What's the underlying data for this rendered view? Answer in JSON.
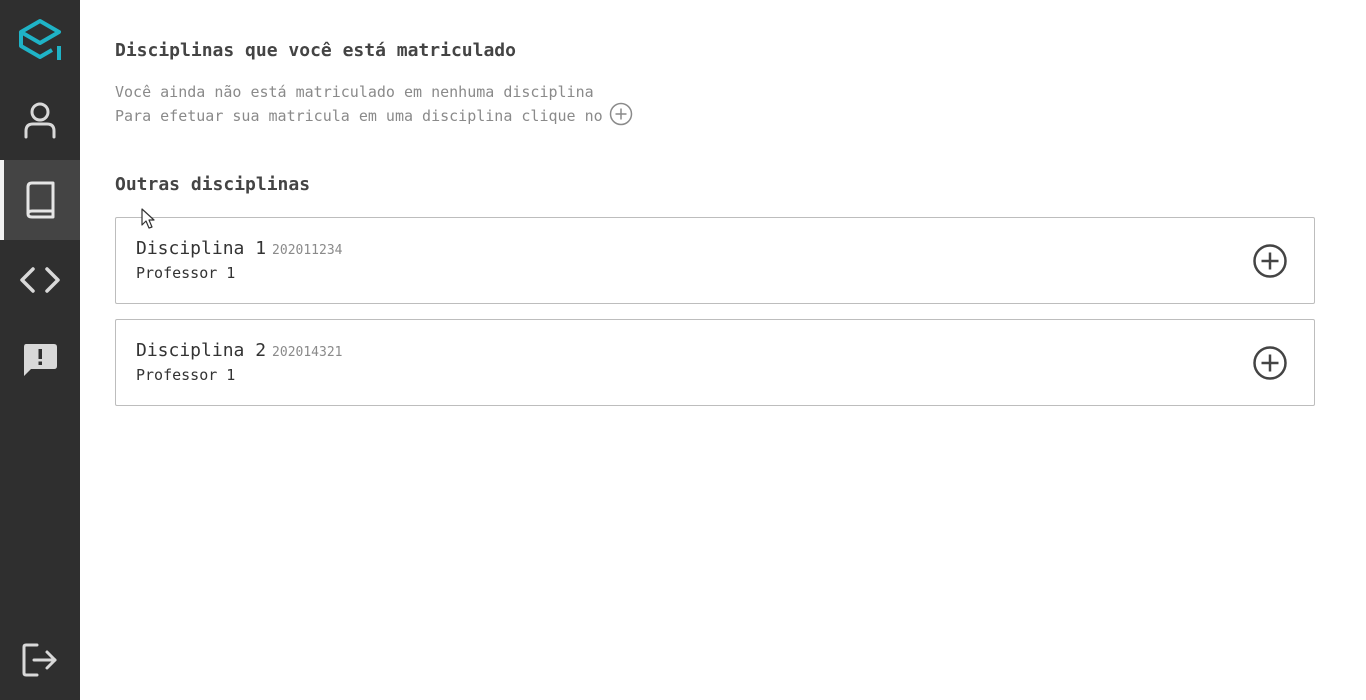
{
  "sidebar": {
    "logo_icon": "graduation-cap-logo-icon",
    "items": [
      {
        "name": "user",
        "icon": "user-icon",
        "active": false
      },
      {
        "name": "subjects",
        "icon": "book-icon",
        "active": true
      },
      {
        "name": "code",
        "icon": "code-icon",
        "active": false
      },
      {
        "name": "feedback",
        "icon": "feedback-icon",
        "active": false
      }
    ],
    "logout_icon": "logout-icon"
  },
  "enrolled": {
    "title": "Disciplinas que você está matriculado",
    "empty_line1": "Você ainda não está matriculado em nenhuma disciplina",
    "empty_line2": "Para efetuar sua matricula em uma disciplina clique no"
  },
  "others": {
    "title": "Outras disciplinas",
    "courses": [
      {
        "name": "Disciplina 1",
        "code": "202011234",
        "professor": "Professor 1"
      },
      {
        "name": "Disciplina 2",
        "code": "202014321",
        "professor": "Professor 1"
      }
    ]
  },
  "colors": {
    "sidebar_bg": "#2f2f2f",
    "sidebar_active_bg": "#444444",
    "accent": "#1fb3c6",
    "icon_gray": "#d9d9d9",
    "text_muted": "#8a8a8a",
    "card_border": "#bdbdbd"
  }
}
